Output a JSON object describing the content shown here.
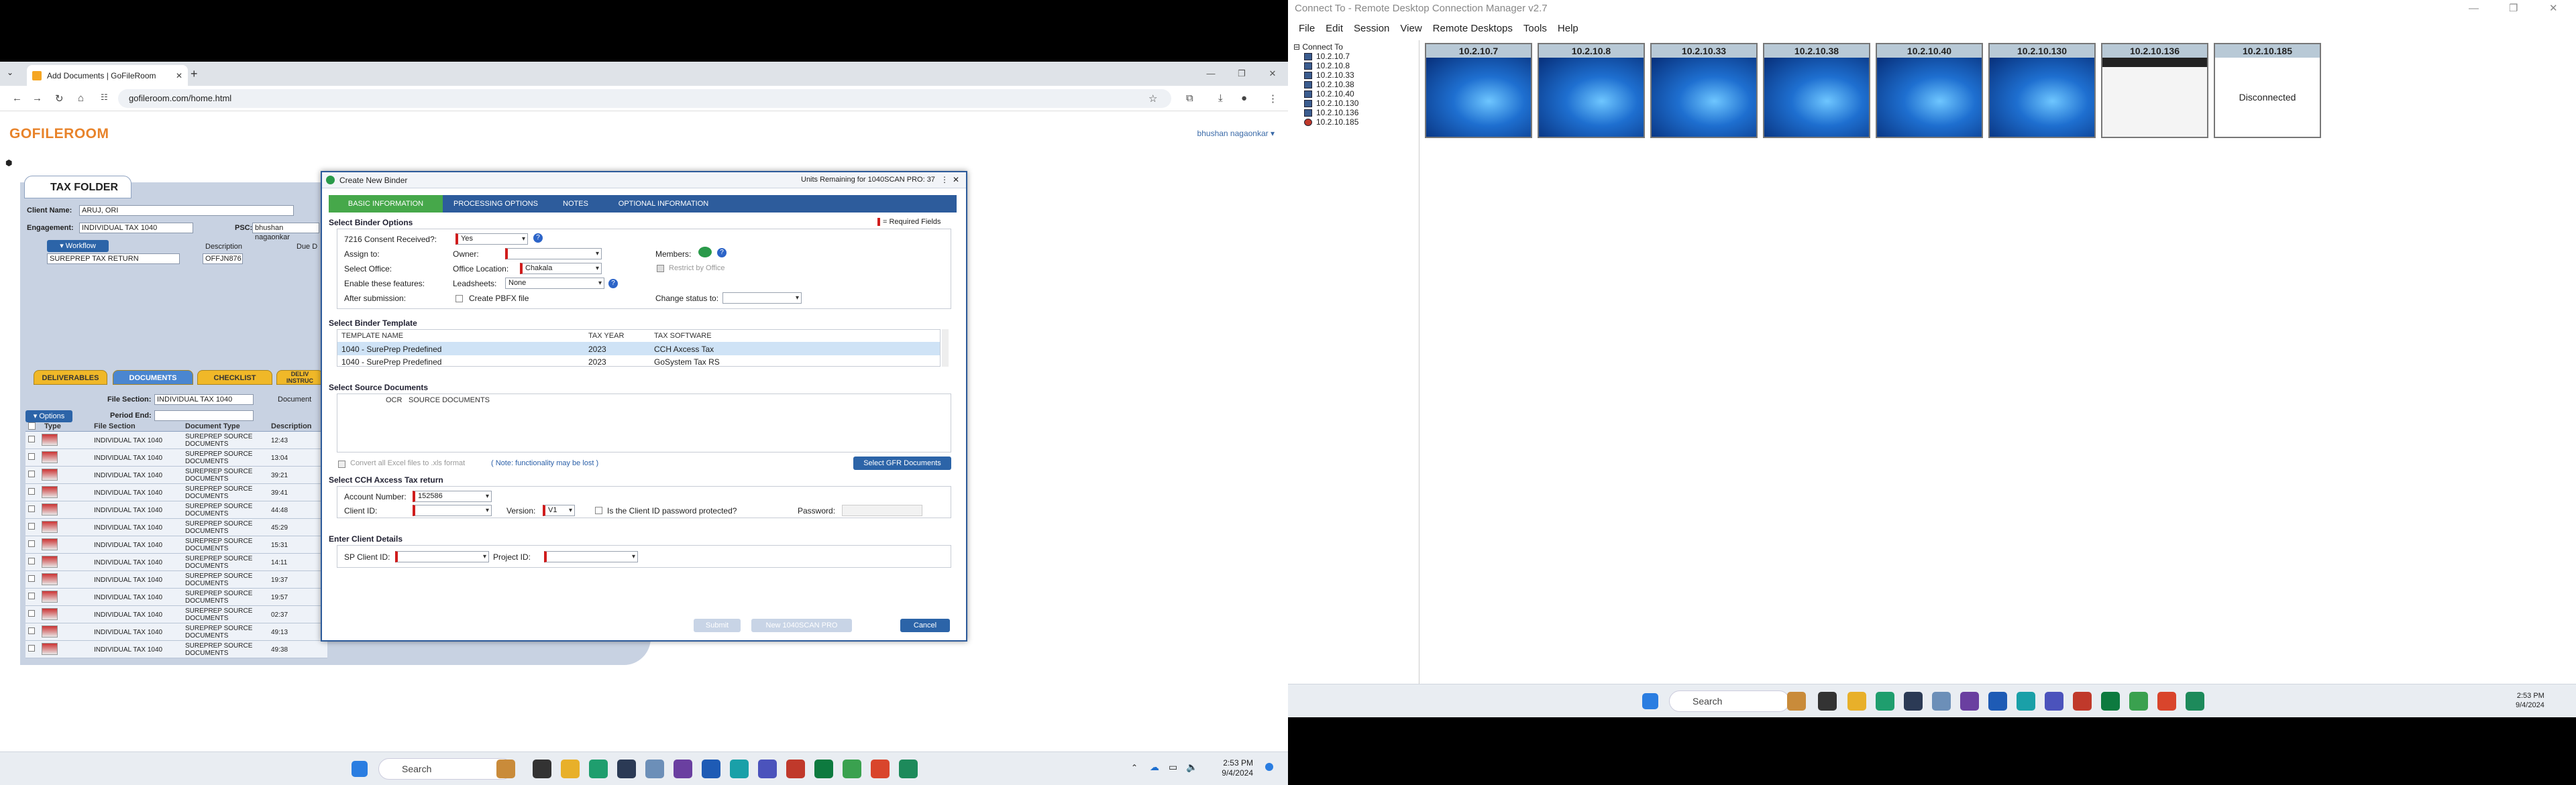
{
  "browser": {
    "tab_title": "Add Documents | GoFileRoom",
    "url": "gofileroom.com/home.html"
  },
  "page": {
    "logo": "GOFILEROOM",
    "user": "bhushan nagaonkar",
    "tax_folder_title": "TAX FOLDER",
    "client_name_label": "Client Name:",
    "client_name_value": "ARUJ, ORI",
    "engagement_label": "Engagement:",
    "engagement_value": "INDIVIDUAL TAX 1040",
    "psc_label": "PSC:",
    "psc_value": "bhushan nagaonkar",
    "workflow_label": "Workflow",
    "description_label": "Description",
    "due_label": "Due D",
    "workflow_value": "SUREPREP TAX RETURN",
    "workflow_desc": "OFFJN876",
    "subtabs": [
      "DELIVERABLES",
      "DOCUMENTS",
      "CHECKLIST",
      "DELIV INSTRUC"
    ],
    "file_section_label": "File Section:",
    "file_section_value": "INDIVIDUAL TAX 1040",
    "period_end_label": "Period End:",
    "document_label": "Document",
    "options_label": "Options",
    "doc_headers": [
      "Type",
      "File Section",
      "Document Type",
      "Description"
    ],
    "documents": [
      {
        "section": "INDIVIDUAL TAX 1040",
        "type": "SUREPREP SOURCE DOCUMENTS",
        "desc": "12:43"
      },
      {
        "section": "INDIVIDUAL TAX 1040",
        "type": "SUREPREP SOURCE DOCUMENTS",
        "desc": "13:04"
      },
      {
        "section": "INDIVIDUAL TAX 1040",
        "type": "SUREPREP SOURCE DOCUMENTS",
        "desc": "39:21"
      },
      {
        "section": "INDIVIDUAL TAX 1040",
        "type": "SUREPREP SOURCE DOCUMENTS",
        "desc": "39:41"
      },
      {
        "section": "INDIVIDUAL TAX 1040",
        "type": "SUREPREP SOURCE DOCUMENTS",
        "desc": "44:48"
      },
      {
        "section": "INDIVIDUAL TAX 1040",
        "type": "SUREPREP SOURCE DOCUMENTS",
        "desc": "45:29"
      },
      {
        "section": "INDIVIDUAL TAX 1040",
        "type": "SUREPREP SOURCE DOCUMENTS",
        "desc": "15:31"
      },
      {
        "section": "INDIVIDUAL TAX 1040",
        "type": "SUREPREP SOURCE DOCUMENTS",
        "desc": "14:11"
      },
      {
        "section": "INDIVIDUAL TAX 1040",
        "type": "SUREPREP SOURCE DOCUMENTS",
        "desc": "19:37"
      },
      {
        "section": "INDIVIDUAL TAX 1040",
        "type": "SUREPREP SOURCE DOCUMENTS",
        "desc": "19:57"
      },
      {
        "section": "INDIVIDUAL TAX 1040",
        "type": "SUREPREP SOURCE DOCUMENTS",
        "desc": "02:37"
      },
      {
        "section": "INDIVIDUAL TAX 1040",
        "type": "SUREPREP SOURCE DOCUMENTS",
        "desc": "49:13"
      },
      {
        "section": "INDIVIDUAL TAX 1040",
        "type": "SUREPREP SOURCE DOCUMENTS",
        "desc": "49:38"
      }
    ]
  },
  "dialog": {
    "title": "Create New Binder",
    "units": "Units Remaining for 1040SCAN PRO: 37",
    "tabs": [
      "BASIC INFORMATION",
      "PROCESSING OPTIONS",
      "NOTES",
      "OPTIONAL INFORMATION"
    ],
    "required_note": "= Required Fields",
    "sec_options": "Select Binder Options",
    "consent_label": "7216 Consent Received?:",
    "consent_value": "Yes",
    "assign_label": "Assign to:",
    "owner_label": "Owner:",
    "members_label": "Members:",
    "office_label": "Select Office:",
    "office_location_label": "Office Location:",
    "office_location_value": "Chakala",
    "restrict_label": "Restrict by Office",
    "features_label": "Enable these features:",
    "leadsheets_label": "Leadsheets:",
    "leadsheets_value": "None",
    "after_label": "After submission:",
    "pbfx_label": "Create PBFX file",
    "change_status_label": "Change status to:",
    "sec_template": "Select Binder Template",
    "template_headers": [
      "TEMPLATE NAME",
      "TAX YEAR",
      "TAX SOFTWARE"
    ],
    "templates": [
      {
        "name": "1040 - SurePrep Predefined",
        "year": "2023",
        "software": "CCH Axcess Tax"
      },
      {
        "name": "1040 - SurePrep Predefined",
        "year": "2023",
        "software": "GoSystem Tax RS"
      }
    ],
    "sec_source": "Select Source Documents",
    "source_headers": [
      "OCR",
      "SOURCE DOCUMENTS"
    ],
    "convert_label": "Convert all Excel files to .xls format",
    "note_link": "( Note: functionality may be lost )",
    "select_gfr": "Select GFR Documents",
    "sec_cch": "Select CCH Axcess Tax return",
    "account_label": "Account Number:",
    "account_value": "152586",
    "client_id_label": "Client ID:",
    "version_label": "Version:",
    "version_value": "V1",
    "protected_label": "Is the Client ID password protected?",
    "password_label": "Password:",
    "sec_client": "Enter Client Details",
    "sp_client_label": "SP Client ID:",
    "project_label": "Project ID:",
    "submit": "Submit",
    "new_1040": "New 1040SCAN PRO",
    "cancel": "Cancel"
  },
  "taskbar": {
    "search": "Search",
    "time": "2:53 PM",
    "date": "9/4/2024"
  },
  "rdcman": {
    "title": "Connect To - Remote Desktop Connection Manager v2.7",
    "menu": [
      "File",
      "Edit",
      "Session",
      "View",
      "Remote Desktops",
      "Tools",
      "Help"
    ],
    "tree_root": "Connect To",
    "servers": [
      "10.2.10.7",
      "10.2.10.8",
      "10.2.10.33",
      "10.2.10.38",
      "10.2.10.40",
      "10.2.10.130",
      "10.2.10.136",
      "10.2.10.185"
    ],
    "thumbnails": [
      "10.2.10.7",
      "10.2.10.8",
      "10.2.10.33",
      "10.2.10.38",
      "10.2.10.40",
      "10.2.10.130",
      "10.2.10.136",
      "10.2.10.185"
    ],
    "disconnected": "Disconnected",
    "taskbar_search": "Search",
    "time": "2:53 PM",
    "date": "9/4/2024"
  }
}
